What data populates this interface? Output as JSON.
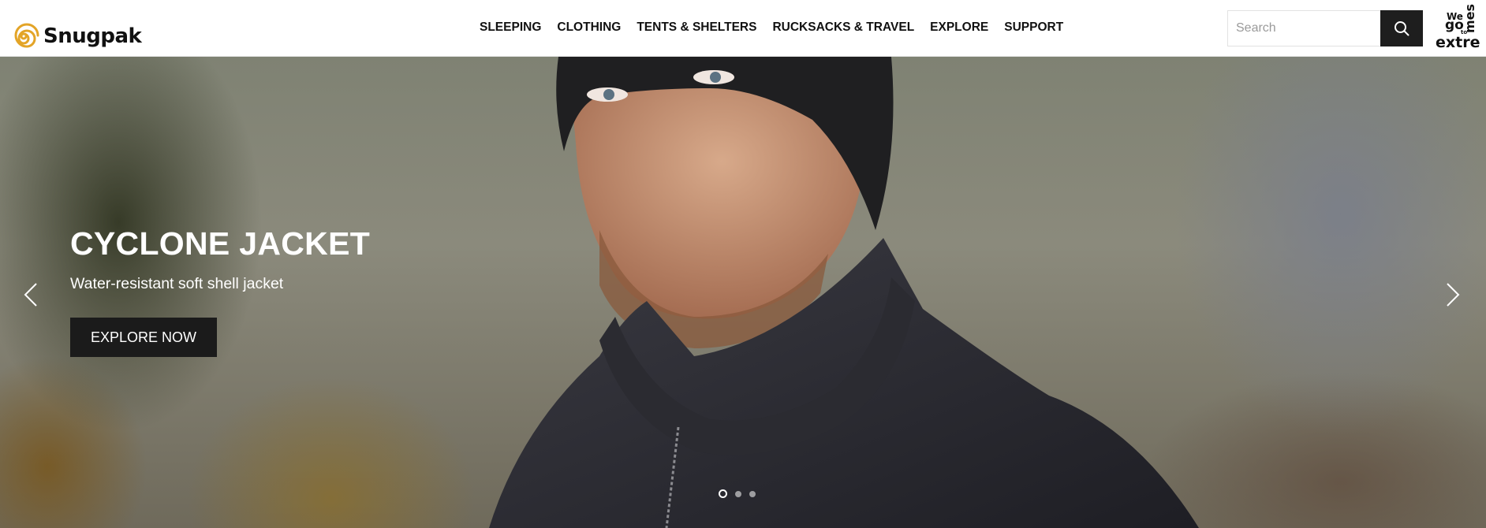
{
  "header": {
    "brand": "Snugpak",
    "nav": [
      {
        "label": "SLEEPING"
      },
      {
        "label": "CLOTHING"
      },
      {
        "label": "TENTS & SHELTERS"
      },
      {
        "label": "RUCKSACKS & TRAVEL"
      },
      {
        "label": "EXPLORE"
      },
      {
        "label": "SUPPORT"
      }
    ],
    "search": {
      "placeholder": "Search",
      "value": ""
    },
    "tagline": {
      "we": "We",
      "go": "go",
      "to": "to",
      "extre": "extre",
      "mes": "mes"
    }
  },
  "hero": {
    "title": "CYCLONE JACKET",
    "subtitle": "Water-resistant soft shell jacket",
    "cta_label": "EXPLORE NOW",
    "slides_total": 3,
    "active_slide": 1
  },
  "icons": {
    "logo": "snail-spiral-icon",
    "search": "search-icon",
    "prev": "chevron-left-icon",
    "next": "chevron-right-icon"
  },
  "colors": {
    "logo_accent": "#e3a427",
    "button_dark": "#1b1b1b",
    "text": "#111111"
  }
}
